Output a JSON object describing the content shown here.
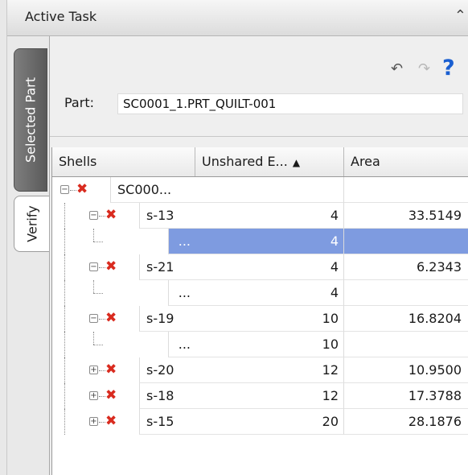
{
  "panel": {
    "title": "Active Task",
    "collapse_icon": "double-chevron-up-icon",
    "side_tabs": [
      {
        "label": "Selected Part",
        "selected": true
      },
      {
        "label": "Verify",
        "selected": false
      }
    ]
  },
  "toolbar": {
    "undo_icon": "undo-icon",
    "redo_icon": "redo-icon",
    "help_icon": "help-icon",
    "close_icon": "close-icon"
  },
  "part": {
    "label": "Part:",
    "value": "SC0001_1.PRT_QUILT-001"
  },
  "table": {
    "columns": [
      "Shells",
      "Unshared E...",
      "Area"
    ],
    "sort_column": "Unshared E...",
    "sort_direction": "ascending",
    "rows": [
      {
        "name": "SC000...",
        "unshared": "",
        "area": "",
        "level": 0,
        "toggle": "minus",
        "has_error": true,
        "selected": false
      },
      {
        "name": "s-13",
        "unshared": "4",
        "area": "33.5149",
        "level": 1,
        "toggle": "minus",
        "has_error": true,
        "selected": false
      },
      {
        "name": "...",
        "unshared": "4",
        "area": "",
        "level": 2,
        "toggle": "none",
        "has_error": false,
        "selected": true
      },
      {
        "name": "s-21",
        "unshared": "4",
        "area": "6.2343",
        "level": 1,
        "toggle": "minus",
        "has_error": true,
        "selected": false
      },
      {
        "name": "...",
        "unshared": "4",
        "area": "",
        "level": 2,
        "toggle": "none",
        "has_error": false,
        "selected": false
      },
      {
        "name": "s-19",
        "unshared": "10",
        "area": "16.8204",
        "level": 1,
        "toggle": "minus",
        "has_error": true,
        "selected": false
      },
      {
        "name": "...",
        "unshared": "10",
        "area": "",
        "level": 2,
        "toggle": "none",
        "has_error": false,
        "selected": false
      },
      {
        "name": "s-20",
        "unshared": "12",
        "area": "10.9500",
        "level": 1,
        "toggle": "plus",
        "has_error": true,
        "selected": false
      },
      {
        "name": "s-18",
        "unshared": "12",
        "area": "17.3788",
        "level": 1,
        "toggle": "plus",
        "has_error": true,
        "selected": false
      },
      {
        "name": "s-15",
        "unshared": "20",
        "area": "28.1876",
        "level": 1,
        "toggle": "plus",
        "has_error": true,
        "selected": false
      }
    ]
  }
}
